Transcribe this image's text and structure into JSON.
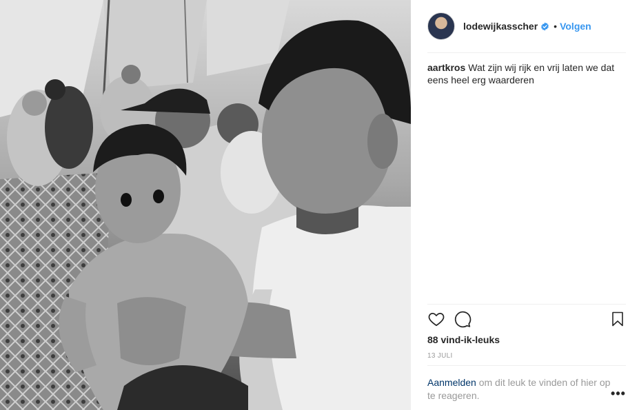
{
  "post": {
    "image_alt": "Zwart-wit foto van een man met een kind in een tent",
    "account": {
      "username": "lodewijkasscher",
      "verified": true,
      "separator": "•",
      "follow_label": "Volgen"
    },
    "caption": {
      "author": "aartkros",
      "text": "Wat zijn wij rijk en vrij laten we dat eens heel erg waarderen"
    },
    "actions": {
      "like_icon": "heart-icon",
      "comment_icon": "comment-icon",
      "save_icon": "bookmark-icon"
    },
    "likes_text": "88 vind-ik-leuks",
    "date_text": "13 JULI",
    "login_prompt": {
      "link_label": "Aanmelden",
      "text": " om dit leuk te vinden of hier op te reageren."
    },
    "more_options_label": "•••"
  },
  "colors": {
    "link_blue": "#3897f0",
    "text_dark": "#262626",
    "text_muted": "#999999",
    "login_link": "#003569",
    "divider": "#efefef"
  }
}
